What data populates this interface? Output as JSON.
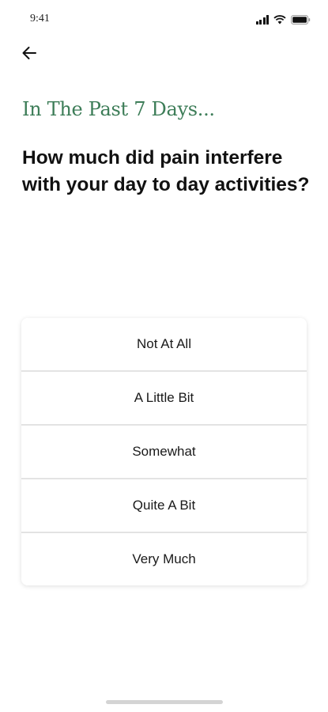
{
  "status_bar": {
    "time": "9:41",
    "icons": [
      "signal-icon",
      "wifi-icon",
      "battery-icon"
    ]
  },
  "nav": {
    "back_icon": "arrow-left-icon"
  },
  "survey": {
    "eyebrow": "In The Past 7 Days...",
    "question": "How much did pain interfere with your day to day activities?",
    "options": [
      {
        "label": "Not At All"
      },
      {
        "label": "A Little Bit"
      },
      {
        "label": "Somewhat"
      },
      {
        "label": "Quite A Bit"
      },
      {
        "label": "Very Much"
      }
    ]
  },
  "colors": {
    "accent_green": "#3d7d58",
    "text": "#111111",
    "divider": "#e3e3e3",
    "home_indicator": "#d4d4d4"
  }
}
